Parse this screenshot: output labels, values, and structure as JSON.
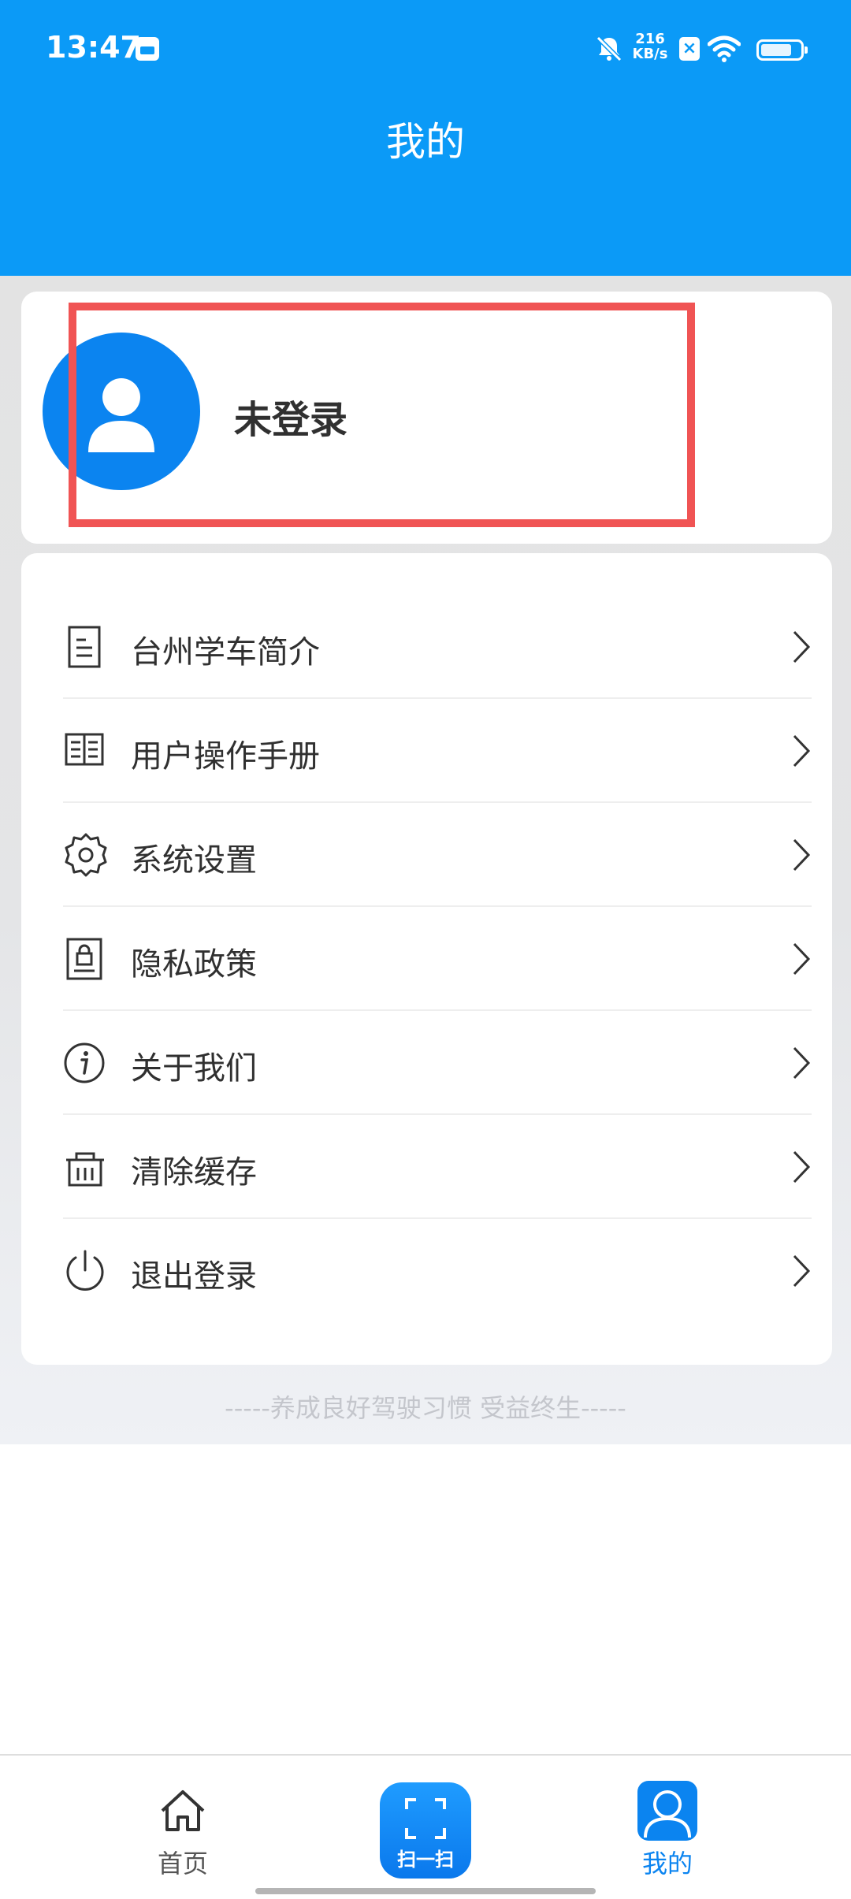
{
  "status_bar": {
    "time": "13:47",
    "net_speed_value": "216",
    "net_speed_unit": "KB/s",
    "sim_label": "×"
  },
  "header": {
    "title": "我的"
  },
  "profile": {
    "name": "未登录"
  },
  "menu": {
    "items": [
      {
        "label": "台州学车简介",
        "icon": "document-icon"
      },
      {
        "label": "用户操作手册",
        "icon": "book-icon"
      },
      {
        "label": "系统设置",
        "icon": "gear-icon"
      },
      {
        "label": "隐私政策",
        "icon": "privacy-lock-icon"
      },
      {
        "label": "关于我们",
        "icon": "info-icon"
      },
      {
        "label": "清除缓存",
        "icon": "basket-icon"
      },
      {
        "label": "退出登录",
        "icon": "power-icon"
      }
    ]
  },
  "footer": {
    "slogan": "-----养成良好驾驶习惯 受益终生-----"
  },
  "tab_bar": {
    "home_label": "首页",
    "scan_label": "扫一扫",
    "profile_label": "我的"
  },
  "colors": {
    "accent": "#0b9af7",
    "active_tab": "#0b84f0",
    "highlight": "#f05454"
  }
}
